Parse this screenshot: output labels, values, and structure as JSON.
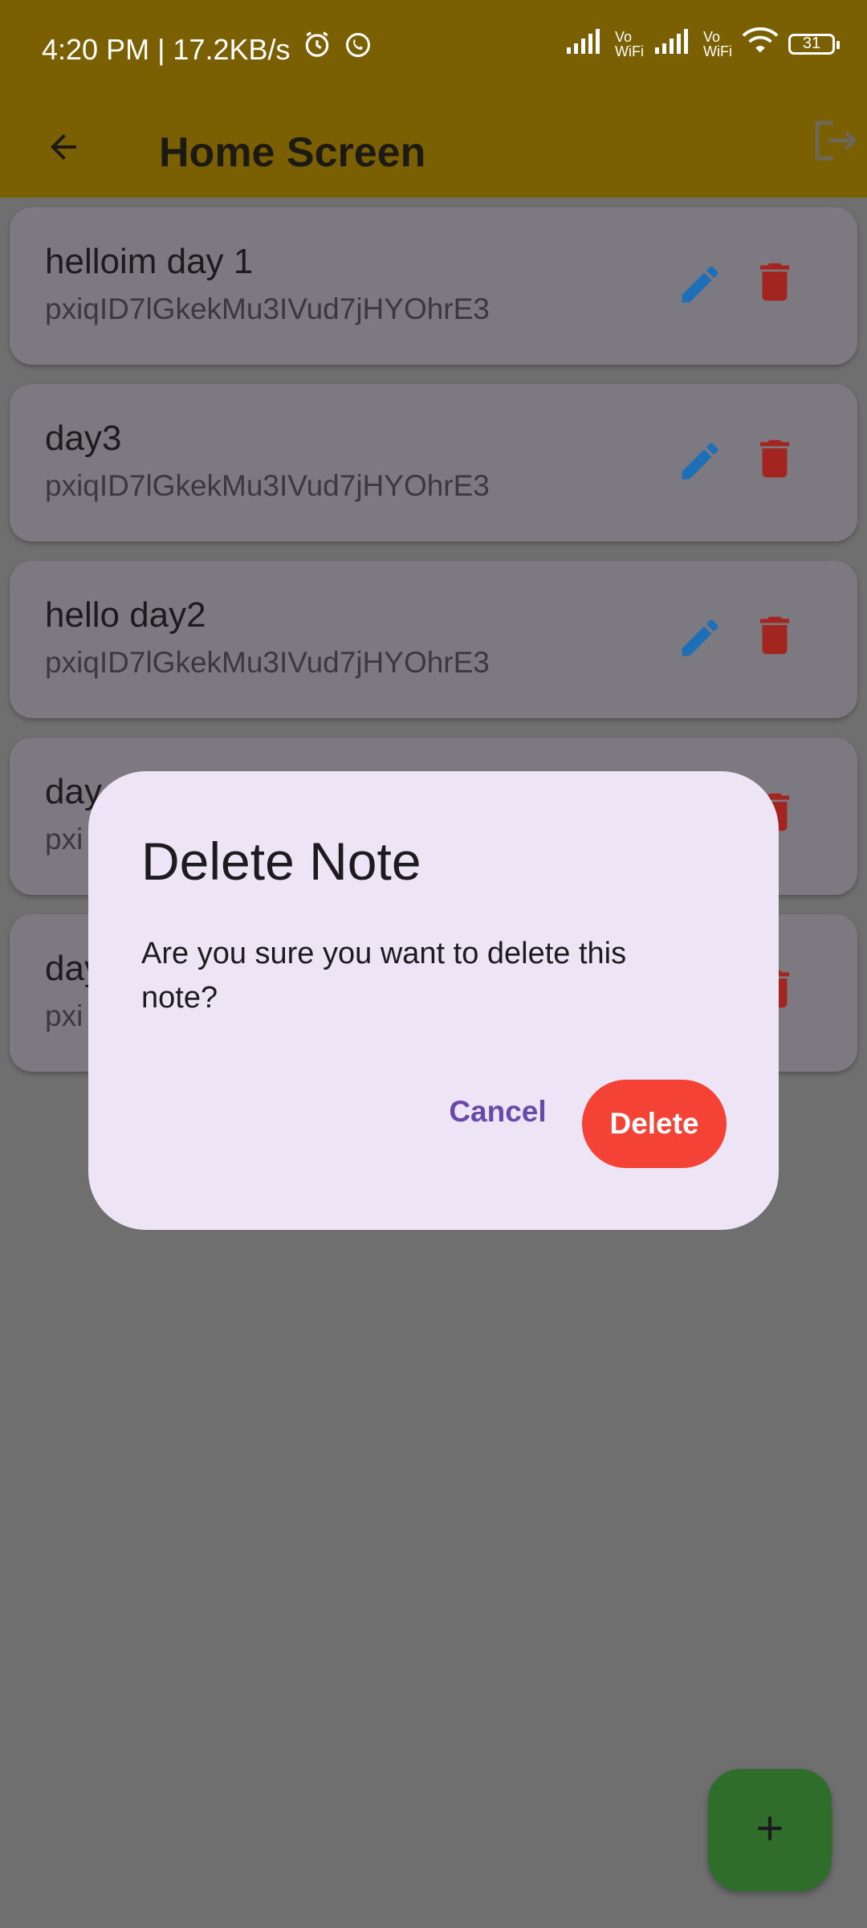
{
  "status_bar": {
    "time_speed": "4:20 PM | 17.2KB/s",
    "vo_label": "Vo",
    "wifi_label": "WiFi",
    "battery": "31"
  },
  "app_bar": {
    "title": "Home Screen"
  },
  "notes": [
    {
      "title": "helloim day 1",
      "subtitle": "pxiqID7lGkekMu3IVud7jHYOhrE3"
    },
    {
      "title": "day3",
      "subtitle": "pxiqID7lGkekMu3IVud7jHYOhrE3"
    },
    {
      "title": "hello day2",
      "subtitle": "pxiqID7lGkekMu3IVud7jHYOhrE3"
    },
    {
      "title": "day",
      "subtitle": "pxi"
    },
    {
      "title": "day",
      "subtitle": "pxi"
    }
  ],
  "dialog": {
    "title": "Delete Note",
    "message": "Are you sure you want to delete this note?",
    "cancel_label": "Cancel",
    "delete_label": "Delete"
  },
  "colors": {
    "app_bar": "#7a6002",
    "edit_icon": "#1d6fb8",
    "delete_icon": "#a3251f",
    "delete_button": "#f44336",
    "fab": "#2f6e2a"
  },
  "icons": {
    "back": "arrow-back-icon",
    "logout": "logout-icon",
    "edit": "pencil-icon",
    "delete": "trash-icon",
    "add": "plus-icon",
    "alarm": "alarm-icon",
    "whatsapp": "whatsapp-icon",
    "signal": "signal-icon",
    "wifi": "wifi-icon"
  }
}
